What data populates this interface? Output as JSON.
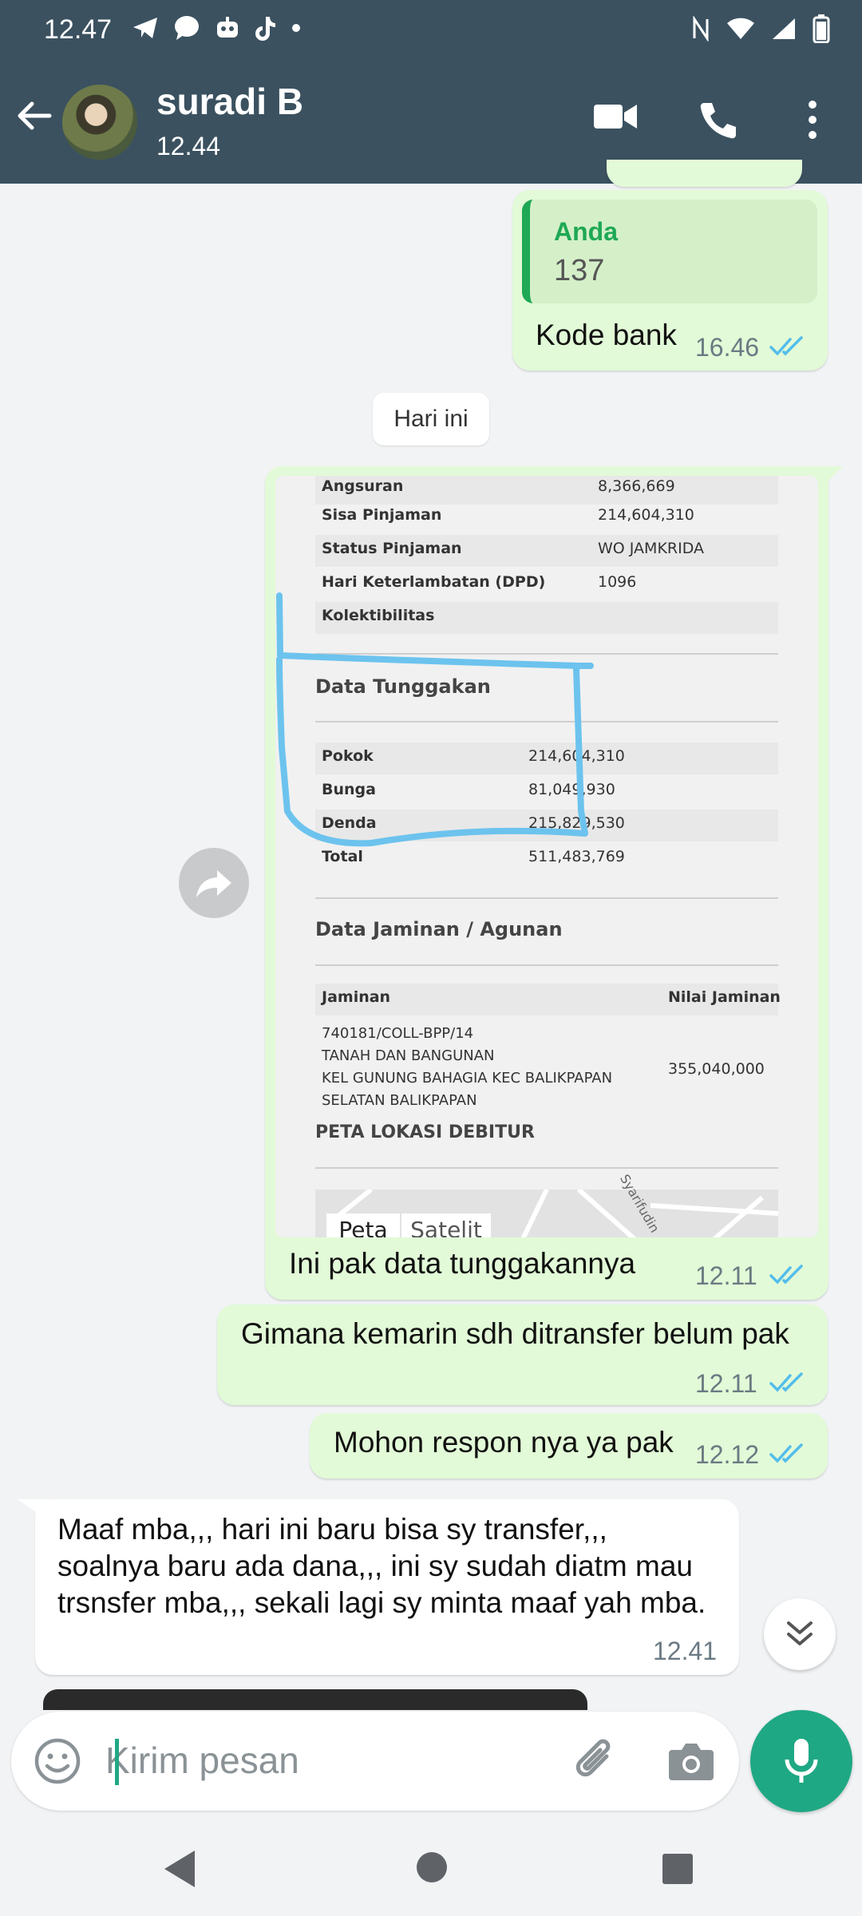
{
  "status_bar": {
    "time": "12.47",
    "left_icons": [
      "telegram-icon",
      "chat-bubble-icon",
      "robot-icon",
      "tiktok-icon",
      "dot-icon"
    ],
    "right_icons": [
      "nfc-icon",
      "wifi-icon",
      "signal-icon",
      "battery-icon"
    ]
  },
  "header": {
    "contact_name": "suradi B",
    "last_seen": "12.44",
    "actions": [
      "video-call-icon",
      "voice-call-icon",
      "more-options-icon"
    ]
  },
  "messages": {
    "m1": {
      "quote_author": "Anda",
      "quote_text": "137",
      "text": "Kode bank",
      "time": "16.46"
    },
    "date_divider": "Hari ini",
    "m2": {
      "caption": "Ini pak data tunggakannya",
      "time": "12.11",
      "image": {
        "top_rows": [
          {
            "label": "Angsuran",
            "value": "8,366,669"
          },
          {
            "label": "Sisa Pinjaman",
            "value": "214,604,310"
          },
          {
            "label": "Status Pinjaman",
            "value": "WO JAMKRIDA"
          },
          {
            "label": "Hari Keterlambatan (DPD)",
            "value": "1096"
          },
          {
            "label": "Kolektibilitas",
            "value": ""
          }
        ],
        "section_tunggakan": "Data Tunggakan",
        "tunggakan_rows": [
          {
            "label": "Pokok",
            "value": "214,604,310"
          },
          {
            "label": "Bunga",
            "value": "81,049,930"
          },
          {
            "label": "Denda",
            "value": "215,829,530"
          },
          {
            "label": "Total",
            "value": "511,483,769"
          }
        ],
        "section_jaminan": "Data Jaminan / Agunan",
        "jaminan_header_left": "Jaminan",
        "jaminan_header_right": "Nilai Jaminan",
        "jaminan_line1": "740181/COLL-BPP/14",
        "jaminan_line2": "TANAH DAN BANGUNAN",
        "jaminan_line3": "KEL GUNUNG BAHAGIA KEC BALIKPAPAN",
        "jaminan_line4": "SELATAN BALIKPAPAN",
        "jaminan_value": "355,040,000",
        "section_peta": "PETA LOKASI DEBITUR",
        "map_tab_1": "Peta",
        "map_tab_2": "Satelit",
        "map_street": "Syarifudin",
        "annotation_color": "#6cc3ee"
      }
    },
    "m3": {
      "text": "Gimana kemarin sdh ditransfer belum pak",
      "time": "12.11"
    },
    "m4": {
      "text": "Mohon respon nya ya pak",
      "time": "12.12"
    },
    "m5": {
      "line1": "Maaf mba,,, hari ini baru bisa sy transfer,,,",
      "line2": "soalnya baru ada dana,,, ini sy sudah diatm mau",
      "line3": "trsnsfer mba,,, sekali lagi sy minta maaf yah mba.",
      "time": "12.41"
    }
  },
  "composer": {
    "placeholder": "Kirim pesan"
  },
  "colors": {
    "header_bg": "#3b5160",
    "outgoing_bubble": "#e2fad7",
    "read_ticks": "#53bdeb",
    "accent_green": "#1fa884"
  }
}
